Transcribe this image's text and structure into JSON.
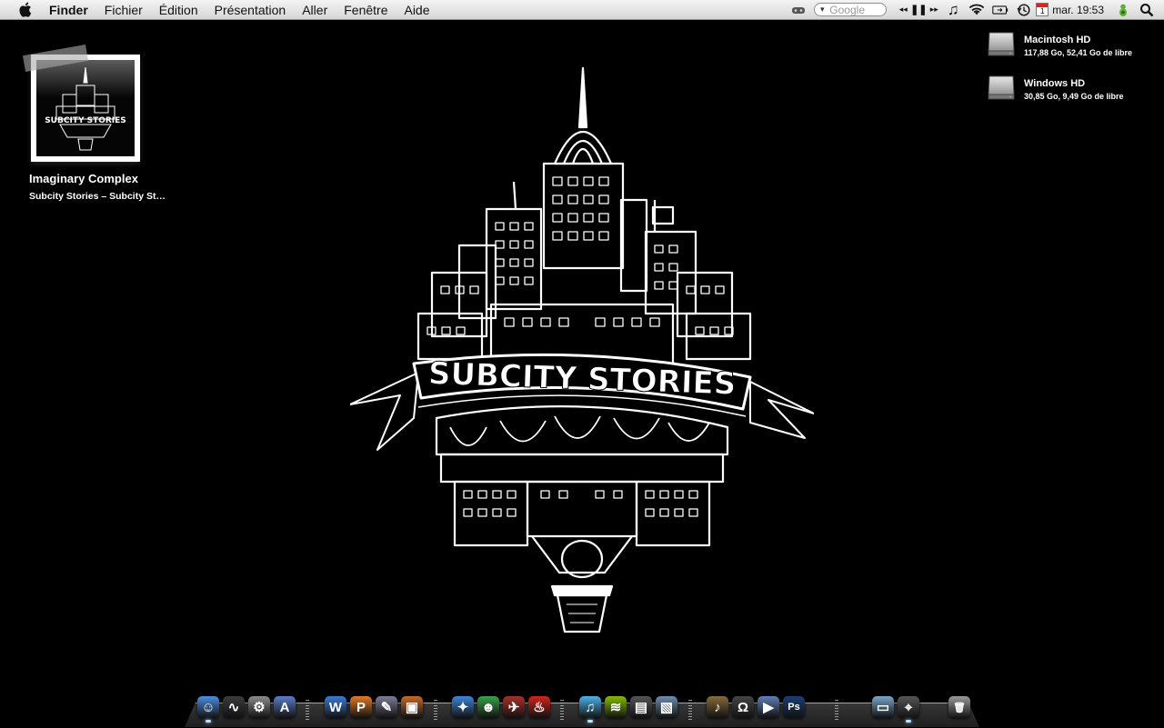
{
  "menubar": {
    "app_name": "Finder",
    "menus": [
      "Fichier",
      "Édition",
      "Présentation",
      "Aller",
      "Fenêtre",
      "Aide"
    ],
    "search_placeholder": "Google",
    "clock": "mar. 19:53",
    "calendar_day": "1"
  },
  "desktop": {
    "drives": [
      {
        "name": "Macintosh HD",
        "info": "117,88 Go, 52,41 Go de libre"
      },
      {
        "name": "Windows HD",
        "info": "30,85 Go, 9,49 Go de libre"
      }
    ],
    "now_playing": {
      "title": "Imaginary Complex",
      "subtitle": "Subcity Stories – Subcity St…",
      "art_text": "SUBCITY STORIES"
    },
    "wallpaper_text": "SUBCITY STORIES"
  },
  "dock": {
    "icons": [
      {
        "name": "finder",
        "color": "#4a8fe0",
        "glyph": "☺"
      },
      {
        "name": "activity-monitor",
        "color": "#3b3b3b",
        "glyph": "∿"
      },
      {
        "name": "system-preferences",
        "color": "#8c8c8c",
        "glyph": "⚙"
      },
      {
        "name": "text-editor",
        "color": "#5a7fc8",
        "glyph": "A"
      },
      {
        "name": "word",
        "color": "#3b7cd6",
        "glyph": "W"
      },
      {
        "name": "powerpoint",
        "color": "#e07a28",
        "glyph": "P"
      },
      {
        "name": "script-editor",
        "color": "#7d7d9a",
        "glyph": "✎"
      },
      {
        "name": "keynote",
        "color": "#c46a2a",
        "glyph": "▣"
      },
      {
        "name": "safari",
        "color": "#3d86d9",
        "glyph": "✦"
      },
      {
        "name": "messenger",
        "color": "#3aa24a",
        "glyph": "☻"
      },
      {
        "name": "flashget",
        "color": "#a8302a",
        "glyph": "✈"
      },
      {
        "name": "flame-app",
        "color": "#d1241c",
        "glyph": "♨"
      },
      {
        "name": "itunes",
        "color": "#4bb2e8",
        "glyph": "♫"
      },
      {
        "name": "spotify",
        "color": "#84bd00",
        "glyph": "≋"
      },
      {
        "name": "final-cut",
        "color": "#555555",
        "glyph": "▤"
      },
      {
        "name": "iphoto",
        "color": "#6b8fb0",
        "glyph": "▧"
      },
      {
        "name": "garageband",
        "color": "#8a6a3a",
        "glyph": "♪"
      },
      {
        "name": "headphones-app",
        "color": "#444444",
        "glyph": "Ω"
      },
      {
        "name": "imovie",
        "color": "#5e7fb6",
        "glyph": "▶"
      },
      {
        "name": "photoshop",
        "color": "#1a3e73",
        "glyph": "Ps"
      },
      {
        "name": "stack-folder",
        "color": "#7aa6cc",
        "glyph": "▭"
      },
      {
        "name": "game-controller",
        "color": "#555555",
        "glyph": "⌖"
      },
      {
        "name": "trash",
        "color": "#9a9a9a",
        "glyph": "🗑"
      }
    ]
  }
}
